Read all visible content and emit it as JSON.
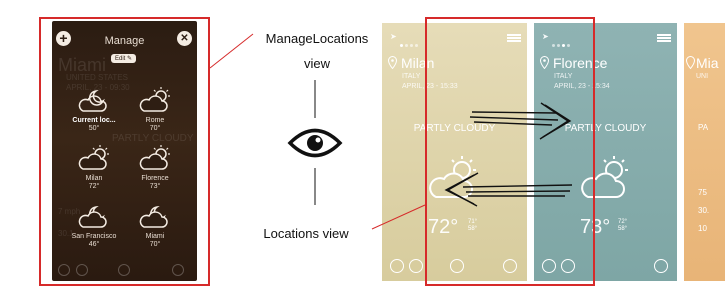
{
  "labels": {
    "manage_view": "ManageLocations\nview",
    "locations_view": "Locations view"
  },
  "manage": {
    "title": "Manage",
    "edit_label": "Edit",
    "add_glyph": "+",
    "close_glyph": "✕",
    "background_ghost": {
      "city": "Miami",
      "country": "UNITED STATES",
      "date": "APRIL, 23 - 09:30",
      "condition": "PARTLY CLOUDY",
      "row1": "7 mph",
      "row2": "30.1"
    },
    "locations": [
      {
        "name": "Current loc...",
        "temp": "50°",
        "icon": "cloud-moon-icon",
        "current": true
      },
      {
        "name": "Rome",
        "temp": "70°",
        "icon": "cloud-sun-icon",
        "current": false
      },
      {
        "name": "Milan",
        "temp": "72°",
        "icon": "cloud-sun-icon",
        "current": false
      },
      {
        "name": "Florence",
        "temp": "73°",
        "icon": "cloud-sun-icon",
        "current": false
      },
      {
        "name": "San Francisco",
        "temp": "46°",
        "icon": "cloud-moon-icon",
        "current": false
      },
      {
        "name": "Miami",
        "temp": "70°",
        "icon": "cloud-moon-icon",
        "current": false
      }
    ]
  },
  "cards": {
    "milan": {
      "city": "Milan",
      "country": "ITALY",
      "date": "APRIL, 23 - 15:33",
      "condition": "PARTLY CLOUDY",
      "temp": "72°",
      "high": "71°",
      "low": "58°",
      "color": "#dcd2a8"
    },
    "florence": {
      "city": "Florence",
      "country": "ITALY",
      "date": "APRIL, 23 - 15:34",
      "condition": "PARTLY CLOUDY",
      "temp": "73°",
      "high": "72°",
      "low": "58°",
      "color": "#86acab"
    },
    "third": {
      "city": "Mia",
      "country": "UNI",
      "condition": "PA",
      "lines": [
        "75",
        "30.",
        "10"
      ],
      "color": "#efbf84"
    }
  },
  "colors": {
    "highlight": "#d62a2a",
    "manage_bg": "#2e1e13"
  }
}
